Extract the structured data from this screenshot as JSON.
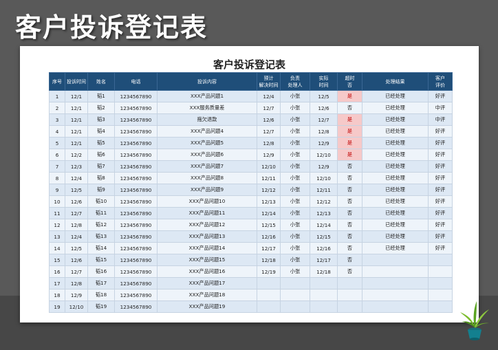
{
  "page_title": "客户投诉登记表",
  "sheet_title": "客户投诉登记表",
  "headers": [
    "序号",
    "投诉时间",
    "姓名",
    "电话",
    "投诉内容",
    "预计\n解决时间",
    "负责\n处理人",
    "实际\n时间",
    "超时\n否",
    "处理结果",
    "客户\n评价"
  ],
  "rows": [
    [
      "1",
      "12/1",
      "韬1",
      "1234567890",
      "XXX产品问题1",
      "12/4",
      "小张",
      "12/5",
      "是",
      "已经处理",
      "好评"
    ],
    [
      "2",
      "12/1",
      "韬2",
      "1234567890",
      "XXX服务质量差",
      "12/7",
      "小张",
      "12/6",
      "否",
      "已经处理",
      "中评"
    ],
    [
      "3",
      "12/1",
      "韬3",
      "1234567890",
      "拖欠退款",
      "12/6",
      "小张",
      "12/7",
      "是",
      "已经处理",
      "中评"
    ],
    [
      "4",
      "12/1",
      "韬4",
      "1234567890",
      "XXX产品问题4",
      "12/7",
      "小张",
      "12/8",
      "是",
      "已经处理",
      "好评"
    ],
    [
      "5",
      "12/1",
      "韬5",
      "1234567890",
      "XXX产品问题5",
      "12/8",
      "小张",
      "12/9",
      "是",
      "已经处理",
      "好评"
    ],
    [
      "6",
      "12/2",
      "韬6",
      "1234567890",
      "XXX产品问题6",
      "12/9",
      "小张",
      "12/10",
      "是",
      "已经处理",
      "好评"
    ],
    [
      "7",
      "12/3",
      "韬7",
      "1234567890",
      "XXX产品问题7",
      "12/10",
      "小张",
      "12/9",
      "否",
      "已经处理",
      "好评"
    ],
    [
      "8",
      "12/4",
      "韬8",
      "1234567890",
      "XXX产品问题8",
      "12/11",
      "小张",
      "12/10",
      "否",
      "已经处理",
      "好评"
    ],
    [
      "9",
      "12/5",
      "韬9",
      "1234567890",
      "XXX产品问题9",
      "12/12",
      "小张",
      "12/11",
      "否",
      "已经处理",
      "好评"
    ],
    [
      "10",
      "12/6",
      "韬10",
      "1234567890",
      "XXX产品问题10",
      "12/13",
      "小张",
      "12/12",
      "否",
      "已经处理",
      "好评"
    ],
    [
      "11",
      "12/7",
      "韬11",
      "1234567890",
      "XXX产品问题11",
      "12/14",
      "小张",
      "12/13",
      "否",
      "已经处理",
      "好评"
    ],
    [
      "12",
      "12/8",
      "韬12",
      "1234567890",
      "XXX产品问题12",
      "12/15",
      "小张",
      "12/14",
      "否",
      "已经处理",
      "好评"
    ],
    [
      "13",
      "12/4",
      "韬13",
      "1234567890",
      "XXX产品问题13",
      "12/16",
      "小张",
      "12/15",
      "否",
      "已经处理",
      "好评"
    ],
    [
      "14",
      "12/5",
      "韬14",
      "1234567890",
      "XXX产品问题14",
      "12/17",
      "小张",
      "12/16",
      "否",
      "已经处理",
      "好评"
    ],
    [
      "15",
      "12/6",
      "韬15",
      "1234567890",
      "XXX产品问题15",
      "12/18",
      "小张",
      "12/17",
      "否",
      "",
      ""
    ],
    [
      "16",
      "12/7",
      "韬16",
      "1234567890",
      "XXX产品问题16",
      "12/19",
      "小张",
      "12/18",
      "否",
      "",
      ""
    ],
    [
      "17",
      "12/8",
      "韬17",
      "1234567890",
      "XXX产品问题17",
      "",
      "",
      "",
      "",
      "",
      ""
    ],
    [
      "18",
      "12/9",
      "韬18",
      "1234567890",
      "XXX产品问题18",
      "",
      "",
      "",
      "",
      "",
      ""
    ],
    [
      "19",
      "12/10",
      "韬19",
      "1234567890",
      "XXX产品问题19",
      "",
      "",
      "",
      "",
      "",
      ""
    ]
  ],
  "colors": {
    "header_bg": "#1f4e79",
    "row_odd": "#dde8f4",
    "row_even": "#eef4fa",
    "overtime_bg": "#f6c9c9",
    "overtime_text": "#c00000"
  },
  "icons": [
    "potted-plant-icon"
  ]
}
